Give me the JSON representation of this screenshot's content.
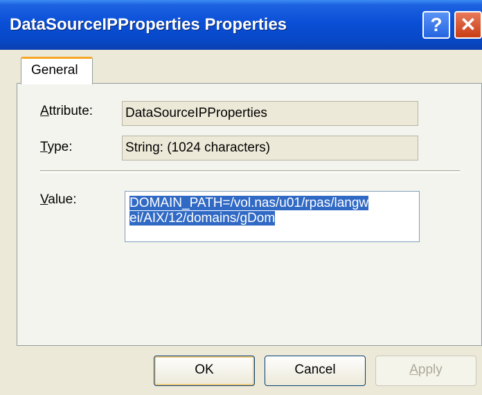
{
  "window": {
    "title": "DataSourceIPProperties Properties",
    "help_glyph": "?",
    "close_glyph": "✕"
  },
  "tabs": [
    {
      "label": "General"
    }
  ],
  "form": {
    "attribute": {
      "label_first": "A",
      "label_rest": "ttribute:",
      "value": "DataSourceIPProperties"
    },
    "type": {
      "label_first": "T",
      "label_rest": "ype:",
      "value": "String: (1024 characters)"
    },
    "value": {
      "label_first": "V",
      "label_rest": "alue:",
      "line1": "DOMAIN_PATH=/vol.nas/u01/rpas/langw",
      "line2": "ei/AIX/12/domains/gDom"
    }
  },
  "buttons": {
    "ok": "OK",
    "cancel": "Cancel",
    "apply_first": "A",
    "apply_rest": "pply"
  }
}
